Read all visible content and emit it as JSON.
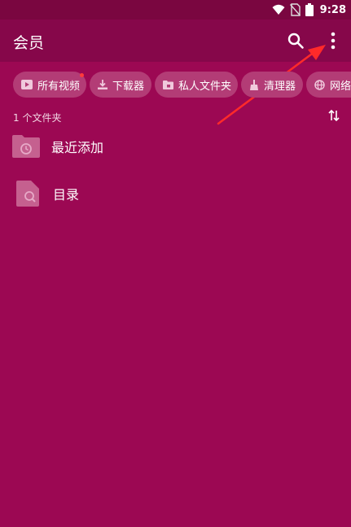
{
  "status_bar": {
    "time": "9:28",
    "icons": [
      "wifi-icon",
      "no-sim-icon",
      "battery-icon"
    ]
  },
  "app_bar": {
    "title": "会员",
    "actions": [
      "search-icon",
      "more-vert-icon"
    ]
  },
  "chips": [
    {
      "label": "所有视频",
      "icon": "video-icon",
      "has_badge": true
    },
    {
      "label": "下载器",
      "icon": "download-icon",
      "has_badge": false
    },
    {
      "label": "私人文件夹",
      "icon": "private-folder-icon",
      "has_badge": false
    },
    {
      "label": "清理器",
      "icon": "broom-icon",
      "has_badge": false
    },
    {
      "label": "网络",
      "icon": "globe-icon",
      "has_badge": false
    }
  ],
  "list": {
    "count_text": "1 个文件夹",
    "items": [
      {
        "label": "最近添加",
        "icon": "recent-folder-icon"
      },
      {
        "label": "目录",
        "icon": "file-search-icon"
      }
    ]
  },
  "colors": {
    "background": "#9c0853",
    "app_bar": "#86074a",
    "status_bar": "#7a0640",
    "chip": "#b33c76",
    "badge": "#ff3b3b",
    "annotation_arrow": "#ff2a2a"
  }
}
